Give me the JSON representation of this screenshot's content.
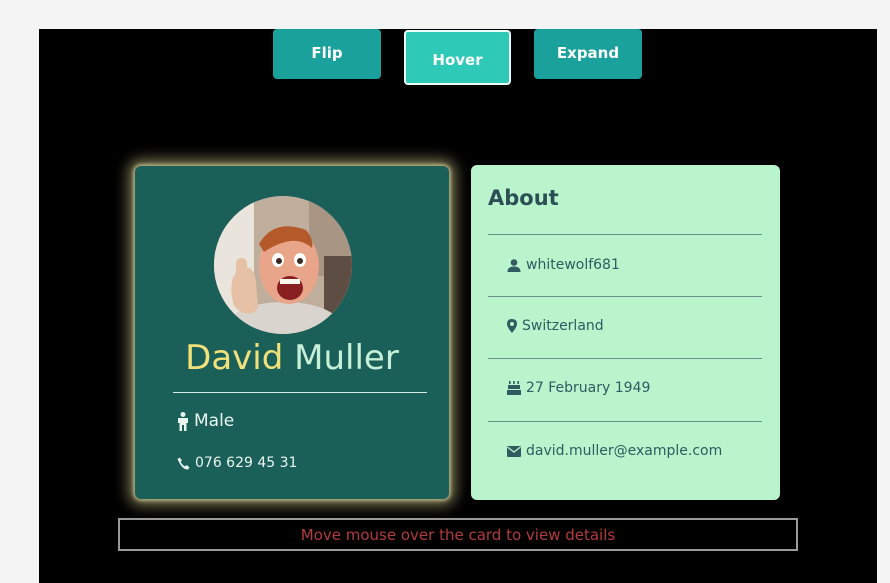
{
  "toolbar": {
    "flip_label": "Flip",
    "hover_label": "Hover",
    "expand_label": "Expand"
  },
  "profile": {
    "first_name": "David",
    "last_name": "Muller",
    "gender": "Male",
    "phone": "076 629 45 31",
    "avatar_icon": "profile-photo"
  },
  "about": {
    "title": "About",
    "username": "whitewolf681",
    "location": "Switzerland",
    "birthday": "27 February 1949",
    "email": "david.muller@example.com"
  },
  "status": {
    "message": "Move mouse over the card to view details"
  },
  "colors": {
    "button": "#1aa19b",
    "button_active": "#2ec9b7",
    "card_front": "#1a5f58",
    "card_about": "#b9f4cc",
    "name_first": "#f2e07a",
    "name_last": "#c7f0d9",
    "status_text": "#b33b3b"
  }
}
